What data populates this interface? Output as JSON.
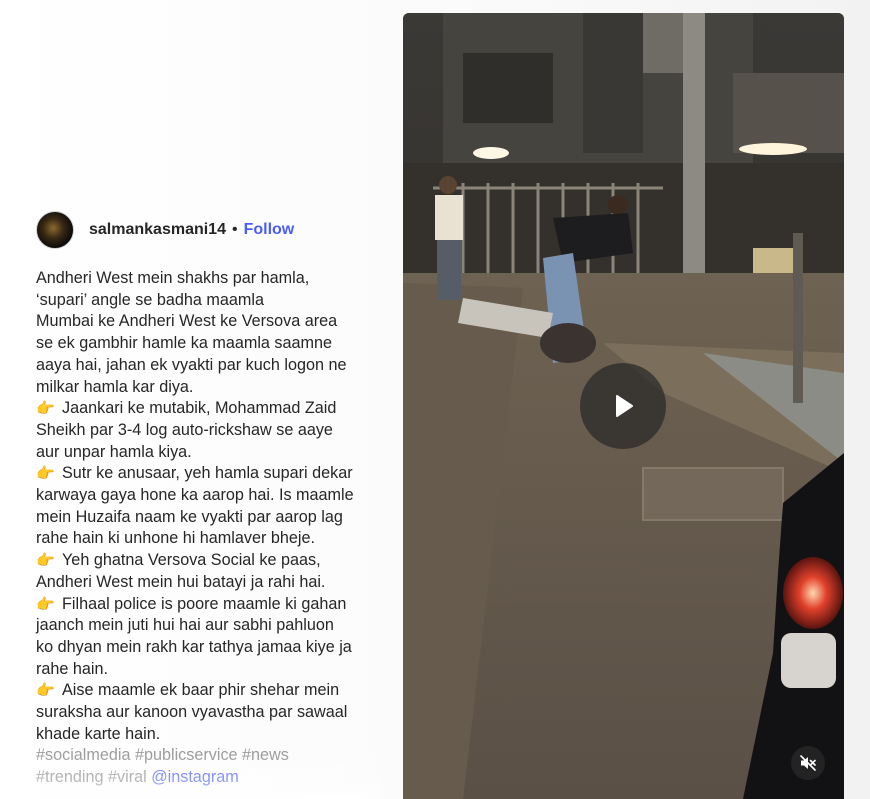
{
  "post": {
    "username": "salmankasmani14",
    "separator": "•",
    "follow_label": "Follow",
    "caption_lines": [
      {
        "emoji": "",
        "text": "Andheri West mein shakhs par hamla,"
      },
      {
        "emoji": "",
        "text": "‘supari’ angle se badha maamla"
      },
      {
        "emoji": "",
        "text": "Mumbai ke Andheri West ke Versova area"
      },
      {
        "emoji": "",
        "text": "se ek gambhir hamle ka maamla saamne"
      },
      {
        "emoji": "",
        "text": "aaya hai, jahan ek vyakti par kuch logon ne"
      },
      {
        "emoji": "",
        "text": "milkar hamla kar diya."
      },
      {
        "emoji": "👉",
        "text": "Jaankari ke mutabik, Mohammad Zaid"
      },
      {
        "emoji": "",
        "text": "Sheikh par 3-4 log auto-rickshaw se aaye"
      },
      {
        "emoji": "",
        "text": "aur unpar hamla kiya."
      },
      {
        "emoji": "👉",
        "text": "Sutr ke anusaar, yeh hamla supari dekar"
      },
      {
        "emoji": "",
        "text": "karwaya gaya hone ka aarop hai. Is maamle"
      },
      {
        "emoji": "",
        "text": "mein Huzaifa naam ke vyakti par aarop lag"
      },
      {
        "emoji": "",
        "text": "rahe hain ki unhone hi hamlaver bheje."
      },
      {
        "emoji": "👉",
        "text": "Yeh ghatna Versova Social ke paas,"
      },
      {
        "emoji": "",
        "text": "Andheri West mein hui batayi ja rahi hai."
      },
      {
        "emoji": "👉",
        "text": "Filhaal police is poore maamle ki gahan"
      },
      {
        "emoji": "",
        "text": "jaanch mein juti hui hai aur sabhi pahluon"
      },
      {
        "emoji": "",
        "text": "ko dhyan mein rakh kar tathya jamaa kiye ja"
      },
      {
        "emoji": "",
        "text": "rahe hain."
      },
      {
        "emoji": "👉",
        "text": "Aise maamle ek baar phir shehar mein"
      },
      {
        "emoji": "",
        "text": "suraksha aur kanoon vyavastha par sawaal"
      },
      {
        "emoji": "",
        "text": "khade karte hain."
      }
    ],
    "hashtags_line1": "#socialmedia #publicservice #news",
    "hashtags_line2": "#trending #viral",
    "mention": "@instagram"
  },
  "video": {
    "play_icon": "play-icon",
    "mute_icon": "muted-speaker-icon"
  }
}
